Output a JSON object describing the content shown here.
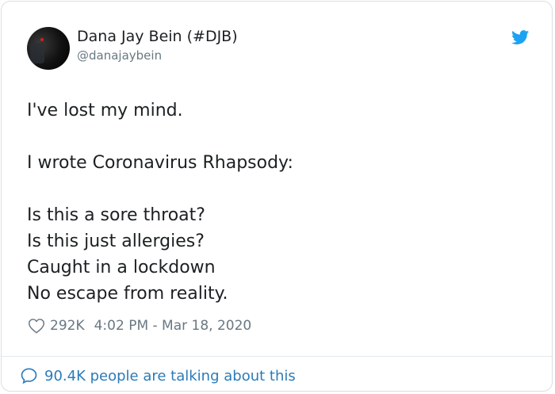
{
  "author": {
    "display_name": "Dana Jay Bein (#DJB)",
    "handle": "@danajaybein",
    "avatar_icon": "profile-photo"
  },
  "tweet": {
    "lines": [
      "I've lost my mind.",
      "",
      "I wrote Coronavirus Rhapsody:",
      "",
      "Is this a sore throat?",
      "Is this just allergies?",
      "Caught in a lockdown",
      "No escape from reality."
    ]
  },
  "meta": {
    "likes": "292K",
    "timestamp": "4:02 PM - Mar 18, 2020",
    "like_icon": "heart-icon"
  },
  "footer": {
    "talking": "90.4K people are talking about this",
    "talking_icon": "speech-bubble-icon"
  },
  "brand": {
    "icon": "twitter-bird-icon",
    "accent": "#1da1f2",
    "link": "#2b7bb9",
    "muted": "#697882",
    "text": "#1c2022"
  }
}
